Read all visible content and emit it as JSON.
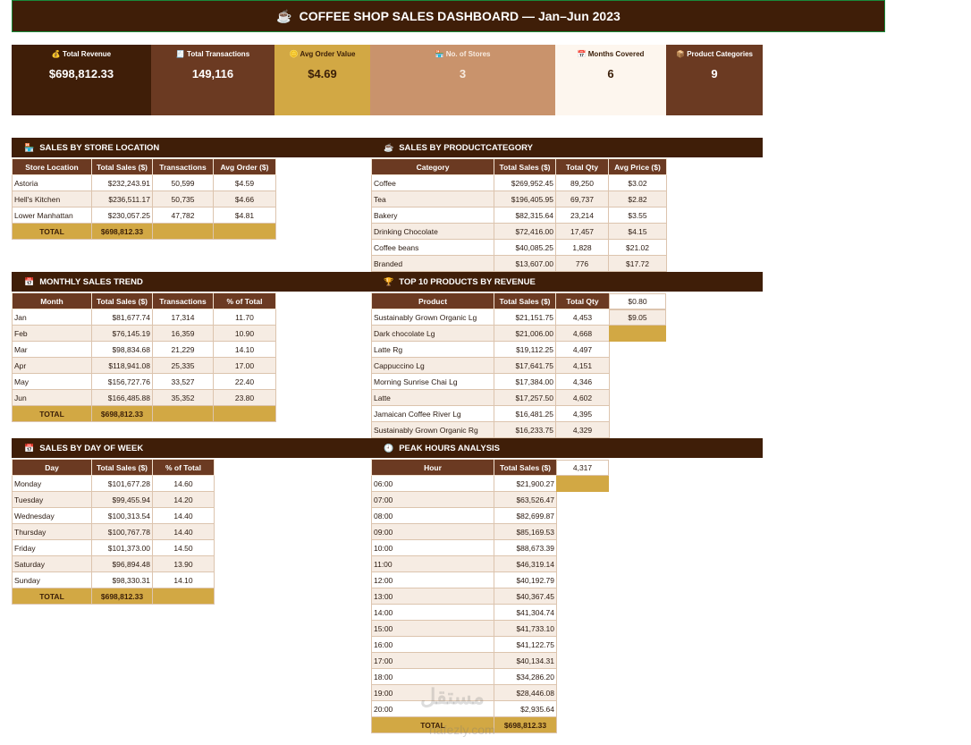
{
  "title": "COFFEE SHOP SALES DASHBOARD — Jan–Jun 2023",
  "kpis": [
    {
      "label": "Total Revenue",
      "value": "$698,812.33",
      "bg": "#3f1e08",
      "fg": "#ffffff"
    },
    {
      "label": "Total Transactions",
      "value": "149,116",
      "bg": "#6b3a22",
      "fg": "#ffffff"
    },
    {
      "label": "Avg Order Value",
      "value": "$4.69",
      "bg": "#d2a844",
      "fg": "#3a1e08"
    },
    {
      "label": "No. of Stores",
      "value": "3",
      "bg": "#c9936c",
      "fg": "#f7ebe0"
    },
    {
      "label": "Months Covered",
      "value": "6",
      "bg": "#fdf6ee",
      "fg": "#3a1e08"
    },
    {
      "label": "Product Categories",
      "value": "9",
      "bg": "#6b3a22",
      "fg": "#ffffff"
    }
  ],
  "store": {
    "title": "SALES BY STORE LOCATION",
    "headers": [
      "Store Location",
      "Total Sales ($)",
      "Transactions",
      "Avg Order ($)"
    ],
    "rows": [
      [
        "Astoria",
        "$232,243.91",
        "50,599",
        "$4.59"
      ],
      [
        "Hell's Kitchen",
        "$236,511.17",
        "50,735",
        "$4.66"
      ],
      [
        "Lower Manhattan",
        "$230,057.25",
        "47,782",
        "$4.81"
      ]
    ],
    "total": [
      "TOTAL",
      "$698,812.33",
      "",
      ""
    ]
  },
  "category": {
    "title": "SALES BY PRODUCTCATEGORY",
    "headers": [
      "Category",
      "Total Sales ($)",
      "Total Qty",
      "Avg Price ($)"
    ],
    "rows": [
      [
        "Coffee",
        "$269,952.45",
        "89,250",
        "$3.02"
      ],
      [
        "Tea",
        "$196,405.95",
        "69,737",
        "$2.82"
      ],
      [
        "Bakery",
        "$82,315.64",
        "23,214",
        "$3.55"
      ],
      [
        "Drinking Chocolate",
        "$72,416.00",
        "17,457",
        "$4.15"
      ],
      [
        "Coffee beans",
        "$40,085.25",
        "1,828",
        "$21.02"
      ],
      [
        "Branded",
        "$13,607.00",
        "776",
        "$17.72"
      ]
    ]
  },
  "monthly": {
    "title": "MONTHLY SALES TREND",
    "headers": [
      "Month",
      "Total Sales ($)",
      "Transactions",
      "% of Total"
    ],
    "rows": [
      [
        "Jan",
        "$81,677.74",
        "17,314",
        "11.70"
      ],
      [
        "Feb",
        "$76,145.19",
        "16,359",
        "10.90"
      ],
      [
        "Mar",
        "$98,834.68",
        "21,229",
        "14.10"
      ],
      [
        "Apr",
        "$118,941.08",
        "25,335",
        "17.00"
      ],
      [
        "May",
        "$156,727.76",
        "33,527",
        "22.40"
      ],
      [
        "Jun",
        "$166,485.88",
        "35,352",
        "23.80"
      ]
    ],
    "total": [
      "TOTAL",
      "$698,812.33",
      "",
      ""
    ]
  },
  "top10": {
    "title": "TOP 10 PRODUCTS BY REVENUE",
    "headers": [
      "Product",
      "Total Sales ($)",
      "Total Qty"
    ],
    "rows": [
      [
        "Sustainably Grown Organic Lg",
        "$21,151.75",
        "4,453"
      ],
      [
        "Dark chocolate Lg",
        "$21,006.00",
        "4,668"
      ],
      [
        "Latte Rg",
        "$19,112.25",
        "4,497"
      ],
      [
        "Cappuccino Lg",
        "$17,641.75",
        "4,151"
      ],
      [
        "Morning Sunrise Chai Lg",
        "$17,384.00",
        "4,346"
      ],
      [
        "Latte",
        "$17,257.50",
        "4,602"
      ],
      [
        "Jamaican Coffee River Lg",
        "$16,481.25",
        "4,395"
      ],
      [
        "Sustainably Grown Organic Rg",
        "$16,233.75",
        "4,329"
      ]
    ],
    "leftover": [
      "$0.80",
      "$9.05"
    ]
  },
  "weekday": {
    "title": "SALES BY DAY OF WEEK",
    "headers": [
      "Day",
      "Total Sales ($)",
      "% of Total"
    ],
    "rows": [
      [
        "Monday",
        "$101,677.28",
        "14.60"
      ],
      [
        "Tuesday",
        "$99,455.94",
        "14.20"
      ],
      [
        "Wednesday",
        "$100,313.54",
        "14.40"
      ],
      [
        "Thursday",
        "$100,767.78",
        "14.40"
      ],
      [
        "Friday",
        "$101,373.00",
        "14.50"
      ],
      [
        "Saturday",
        "$96,894.48",
        "13.90"
      ],
      [
        "Sunday",
        "$98,330.31",
        "14.10"
      ]
    ],
    "total": [
      "TOTAL",
      "$698,812.33",
      ""
    ]
  },
  "peak": {
    "title": "PEAK HOURS ANALYSIS",
    "headers": [
      "Hour",
      "Total Sales ($)"
    ],
    "rows": [
      [
        "06:00",
        "$21,900.27"
      ],
      [
        "07:00",
        "$63,526.47"
      ],
      [
        "08:00",
        "$82,699.87"
      ],
      [
        "09:00",
        "$85,169.53"
      ],
      [
        "10:00",
        "$88,673.39"
      ],
      [
        "11:00",
        "$46,319.14"
      ],
      [
        "12:00",
        "$40,192.79"
      ],
      [
        "13:00",
        "$40,367.45"
      ],
      [
        "14:00",
        "$41,304.74"
      ],
      [
        "15:00",
        "$41,733.10"
      ],
      [
        "16:00",
        "$41,122.75"
      ],
      [
        "17:00",
        "$40,134.31"
      ],
      [
        "18:00",
        "$34,286.20"
      ],
      [
        "19:00",
        "$28,446.08"
      ],
      [
        "20:00",
        "$2,935.64"
      ]
    ],
    "total": [
      "TOTAL",
      "$698,812.33"
    ],
    "leftover": "4,317"
  },
  "watermark": {
    "arabic": "مستقل",
    "latin": "nafezly.com"
  }
}
